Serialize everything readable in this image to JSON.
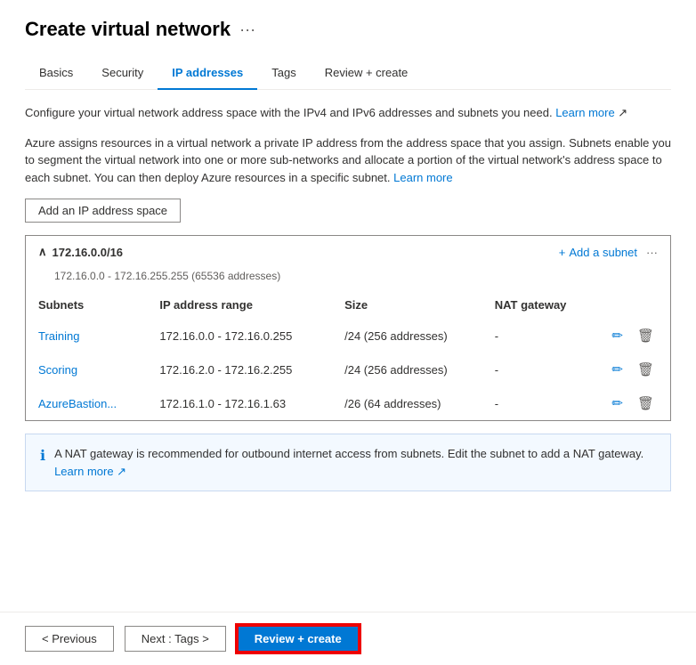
{
  "page": {
    "title": "Create virtual network",
    "ellipsis": "···"
  },
  "tabs": [
    {
      "id": "basics",
      "label": "Basics",
      "active": false
    },
    {
      "id": "security",
      "label": "Security",
      "active": false
    },
    {
      "id": "ip-addresses",
      "label": "IP addresses",
      "active": true
    },
    {
      "id": "tags",
      "label": "Tags",
      "active": false
    },
    {
      "id": "review-create",
      "label": "Review + create",
      "active": false
    }
  ],
  "description1": "Configure your virtual network address space with the IPv4 and IPv6 addresses and subnets you need.",
  "description1_link": "Learn more",
  "description2": "Azure assigns resources in a virtual network a private IP address from the address space that you assign. Subnets enable you to segment the virtual network into one or more sub-networks and allocate a portion of the virtual network's address space to each subnet. You can then deploy Azure resources in a specific subnet.",
  "description2_link": "Learn more",
  "add_ip_btn": "Add an IP address space",
  "ip_block": {
    "cidr": "172.16.0.0/16",
    "range_info": "172.16.0.0 - 172.16.255.255 (65536 addresses)",
    "add_subnet_label": "Add a subnet",
    "more_icon": "···"
  },
  "table": {
    "headers": [
      "Subnets",
      "IP address range",
      "Size",
      "NAT gateway"
    ],
    "rows": [
      {
        "subnet": "Training",
        "ip_range": "172.16.0.0 - 172.16.0.255",
        "size": "/24 (256 addresses)",
        "nat": "-"
      },
      {
        "subnet": "Scoring",
        "ip_range": "172.16.2.0 - 172.16.2.255",
        "size": "/24 (256 addresses)",
        "nat": "-"
      },
      {
        "subnet": "AzureBastion...",
        "ip_range": "172.16.1.0 - 172.16.1.63",
        "size": "/26 (64 addresses)",
        "nat": "-"
      }
    ]
  },
  "info_box": {
    "text": "A NAT gateway is recommended for outbound internet access from subnets. Edit the subnet to add a NAT gateway.",
    "link": "Learn more"
  },
  "footer": {
    "prev_label": "< Previous",
    "next_label": "Next : Tags >",
    "review_label": "Review + create"
  }
}
